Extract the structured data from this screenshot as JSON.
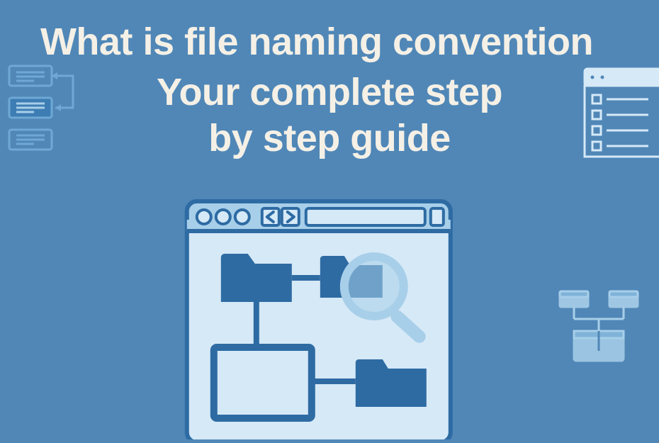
{
  "title": {
    "line1": "What is file naming convention",
    "line2": "Your complete step",
    "line3": "by step guide"
  },
  "colors": {
    "background": "#5087b7",
    "text": "#f5f0e6",
    "lightBlue": "#a8cfe9",
    "darkBlue": "#2e6ba3",
    "iconOutline": "#6fa8d4",
    "browserPanel": "#d6e9f7",
    "browserBorder": "#2e6ba3"
  }
}
